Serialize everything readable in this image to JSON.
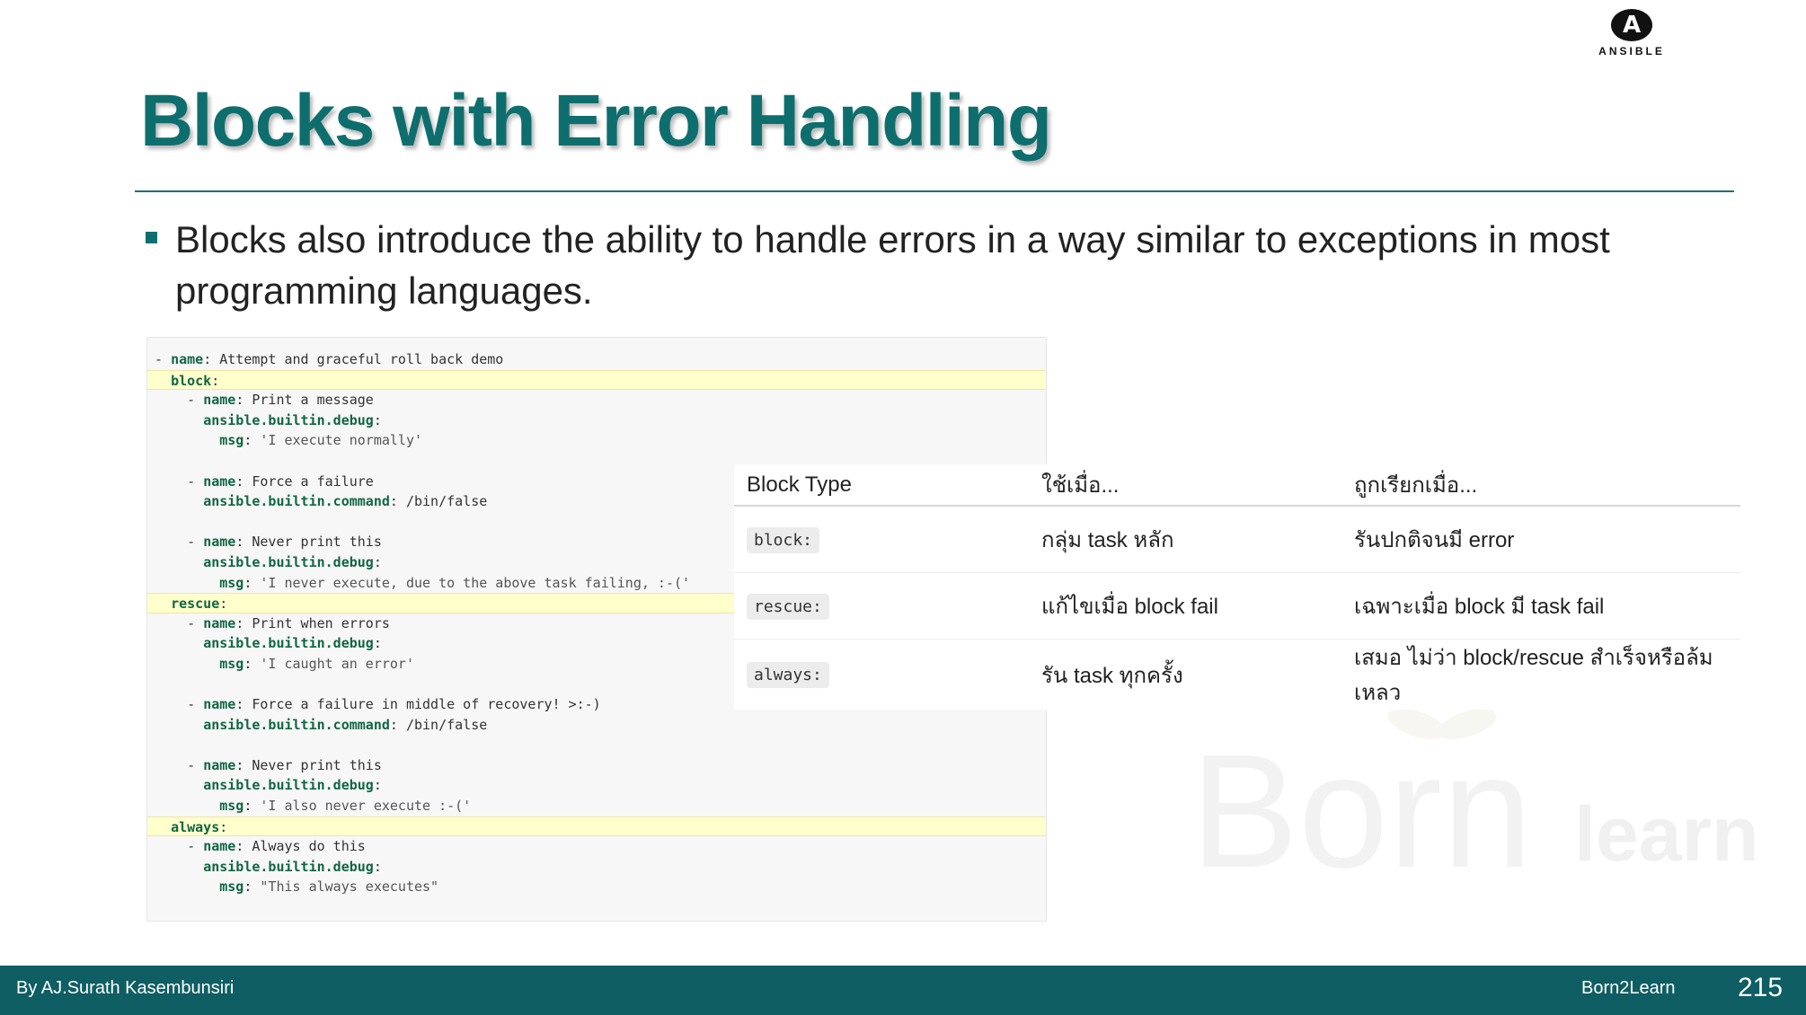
{
  "logo": {
    "wordmark": "ANSIBLE"
  },
  "title": "Blocks with Error Handling",
  "bullet": "Blocks also introduce the ability to handle errors in a way similar to exceptions in most programming languages.",
  "code_lines": [
    {
      "parts": [
        {
          "t": "- ",
          "c": ""
        },
        {
          "t": "name",
          "c": "k"
        },
        {
          "t": ": Attempt and graceful roll back demo",
          "c": ""
        }
      ]
    },
    {
      "hl": true,
      "parts": [
        {
          "t": "  ",
          "c": ""
        },
        {
          "t": "block",
          "c": "k"
        },
        {
          "t": ":",
          "c": ""
        }
      ]
    },
    {
      "parts": [
        {
          "t": "    - ",
          "c": ""
        },
        {
          "t": "name",
          "c": "k"
        },
        {
          "t": ": Print a message",
          "c": ""
        }
      ]
    },
    {
      "parts": [
        {
          "t": "      ",
          "c": ""
        },
        {
          "t": "ansible.builtin.debug",
          "c": "k"
        },
        {
          "t": ":",
          "c": ""
        }
      ]
    },
    {
      "parts": [
        {
          "t": "        ",
          "c": ""
        },
        {
          "t": "msg",
          "c": "k"
        },
        {
          "t": ": ",
          "c": ""
        },
        {
          "t": "'I execute normally'",
          "c": "s"
        }
      ]
    },
    {
      "parts": []
    },
    {
      "parts": [
        {
          "t": "    - ",
          "c": ""
        },
        {
          "t": "name",
          "c": "k"
        },
        {
          "t": ": Force a failure",
          "c": ""
        }
      ]
    },
    {
      "parts": [
        {
          "t": "      ",
          "c": ""
        },
        {
          "t": "ansible.builtin.command",
          "c": "k"
        },
        {
          "t": ": /bin/false",
          "c": ""
        }
      ]
    },
    {
      "parts": []
    },
    {
      "parts": [
        {
          "t": "    - ",
          "c": ""
        },
        {
          "t": "name",
          "c": "k"
        },
        {
          "t": ": Never print this",
          "c": ""
        }
      ]
    },
    {
      "parts": [
        {
          "t": "      ",
          "c": ""
        },
        {
          "t": "ansible.builtin.debug",
          "c": "k"
        },
        {
          "t": ":",
          "c": ""
        }
      ]
    },
    {
      "parts": [
        {
          "t": "        ",
          "c": ""
        },
        {
          "t": "msg",
          "c": "k"
        },
        {
          "t": ": ",
          "c": ""
        },
        {
          "t": "'I never execute, due to the above task failing, :-('",
          "c": "s"
        }
      ]
    },
    {
      "hl": true,
      "parts": [
        {
          "t": "  ",
          "c": ""
        },
        {
          "t": "rescue",
          "c": "k"
        },
        {
          "t": ":",
          "c": ""
        }
      ]
    },
    {
      "parts": [
        {
          "t": "    - ",
          "c": ""
        },
        {
          "t": "name",
          "c": "k"
        },
        {
          "t": ": Print when errors",
          "c": ""
        }
      ]
    },
    {
      "parts": [
        {
          "t": "      ",
          "c": ""
        },
        {
          "t": "ansible.builtin.debug",
          "c": "k"
        },
        {
          "t": ":",
          "c": ""
        }
      ]
    },
    {
      "parts": [
        {
          "t": "        ",
          "c": ""
        },
        {
          "t": "msg",
          "c": "k"
        },
        {
          "t": ": ",
          "c": ""
        },
        {
          "t": "'I caught an error'",
          "c": "s"
        }
      ]
    },
    {
      "parts": []
    },
    {
      "parts": [
        {
          "t": "    - ",
          "c": ""
        },
        {
          "t": "name",
          "c": "k"
        },
        {
          "t": ": Force a failure in middle of recovery! >:-)",
          "c": ""
        }
      ]
    },
    {
      "parts": [
        {
          "t": "      ",
          "c": ""
        },
        {
          "t": "ansible.builtin.command",
          "c": "k"
        },
        {
          "t": ": /bin/false",
          "c": ""
        }
      ]
    },
    {
      "parts": []
    },
    {
      "parts": [
        {
          "t": "    - ",
          "c": ""
        },
        {
          "t": "name",
          "c": "k"
        },
        {
          "t": ": Never print this",
          "c": ""
        }
      ]
    },
    {
      "parts": [
        {
          "t": "      ",
          "c": ""
        },
        {
          "t": "ansible.builtin.debug",
          "c": "k"
        },
        {
          "t": ":",
          "c": ""
        }
      ]
    },
    {
      "parts": [
        {
          "t": "        ",
          "c": ""
        },
        {
          "t": "msg",
          "c": "k"
        },
        {
          "t": ": ",
          "c": ""
        },
        {
          "t": "'I also never execute :-('",
          "c": "s"
        }
      ]
    },
    {
      "hl": true,
      "parts": [
        {
          "t": "  ",
          "c": ""
        },
        {
          "t": "always",
          "c": "k"
        },
        {
          "t": ":",
          "c": ""
        }
      ]
    },
    {
      "parts": [
        {
          "t": "    - ",
          "c": ""
        },
        {
          "t": "name",
          "c": "k"
        },
        {
          "t": ": Always do this",
          "c": ""
        }
      ]
    },
    {
      "parts": [
        {
          "t": "      ",
          "c": ""
        },
        {
          "t": "ansible.builtin.debug",
          "c": "k"
        },
        {
          "t": ":",
          "c": ""
        }
      ]
    },
    {
      "parts": [
        {
          "t": "        ",
          "c": ""
        },
        {
          "t": "msg",
          "c": "k"
        },
        {
          "t": ": ",
          "c": ""
        },
        {
          "t": "\"This always executes\"",
          "c": "s"
        }
      ]
    }
  ],
  "table": {
    "headers": [
      "Block Type",
      "ใช้เมื่อ...",
      "ถูกเรียกเมื่อ..."
    ],
    "rows": [
      [
        "block:",
        "กลุ่ม task หลัก",
        "รันปกติจนมี error"
      ],
      [
        "rescue:",
        "แก้ไขเมื่อ block fail",
        "เฉพาะเมื่อ block มี task fail"
      ],
      [
        "always:",
        "รัน task ทุกครั้ง",
        "เสมอ ไม่ว่า block/rescue สำเร็จหรือล้มเหลว"
      ]
    ]
  },
  "watermark": {
    "main": "Born",
    "sub": "learn"
  },
  "footer": {
    "author": "By AJ.Surath Kasembunsiri",
    "brand": "Born2Learn",
    "page": "215"
  }
}
